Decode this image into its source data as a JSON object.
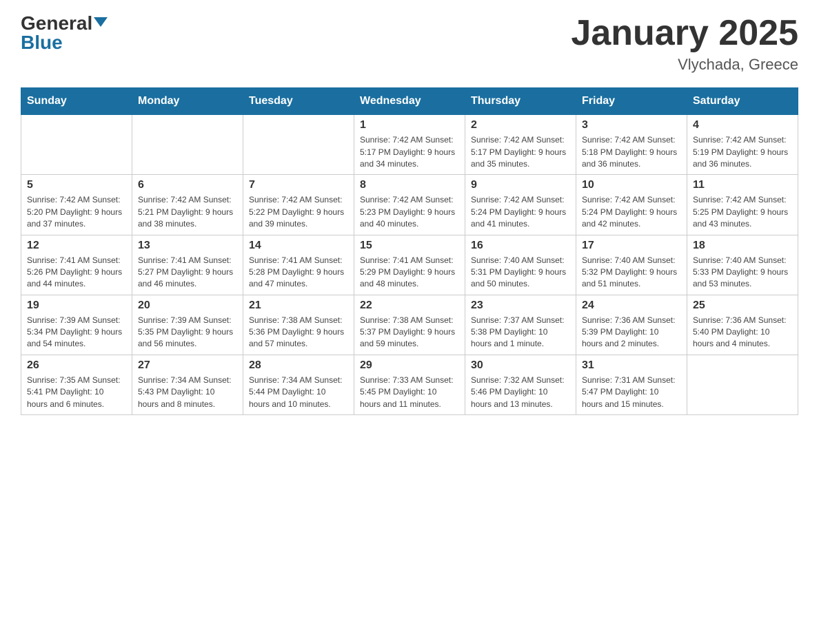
{
  "header": {
    "logo_general": "General",
    "logo_blue": "Blue",
    "month_title": "January 2025",
    "location": "Vlychada, Greece"
  },
  "days_of_week": [
    "Sunday",
    "Monday",
    "Tuesday",
    "Wednesday",
    "Thursday",
    "Friday",
    "Saturday"
  ],
  "weeks": [
    [
      {
        "day": "",
        "info": ""
      },
      {
        "day": "",
        "info": ""
      },
      {
        "day": "",
        "info": ""
      },
      {
        "day": "1",
        "info": "Sunrise: 7:42 AM\nSunset: 5:17 PM\nDaylight: 9 hours and 34 minutes."
      },
      {
        "day": "2",
        "info": "Sunrise: 7:42 AM\nSunset: 5:17 PM\nDaylight: 9 hours and 35 minutes."
      },
      {
        "day": "3",
        "info": "Sunrise: 7:42 AM\nSunset: 5:18 PM\nDaylight: 9 hours and 36 minutes."
      },
      {
        "day": "4",
        "info": "Sunrise: 7:42 AM\nSunset: 5:19 PM\nDaylight: 9 hours and 36 minutes."
      }
    ],
    [
      {
        "day": "5",
        "info": "Sunrise: 7:42 AM\nSunset: 5:20 PM\nDaylight: 9 hours and 37 minutes."
      },
      {
        "day": "6",
        "info": "Sunrise: 7:42 AM\nSunset: 5:21 PM\nDaylight: 9 hours and 38 minutes."
      },
      {
        "day": "7",
        "info": "Sunrise: 7:42 AM\nSunset: 5:22 PM\nDaylight: 9 hours and 39 minutes."
      },
      {
        "day": "8",
        "info": "Sunrise: 7:42 AM\nSunset: 5:23 PM\nDaylight: 9 hours and 40 minutes."
      },
      {
        "day": "9",
        "info": "Sunrise: 7:42 AM\nSunset: 5:24 PM\nDaylight: 9 hours and 41 minutes."
      },
      {
        "day": "10",
        "info": "Sunrise: 7:42 AM\nSunset: 5:24 PM\nDaylight: 9 hours and 42 minutes."
      },
      {
        "day": "11",
        "info": "Sunrise: 7:42 AM\nSunset: 5:25 PM\nDaylight: 9 hours and 43 minutes."
      }
    ],
    [
      {
        "day": "12",
        "info": "Sunrise: 7:41 AM\nSunset: 5:26 PM\nDaylight: 9 hours and 44 minutes."
      },
      {
        "day": "13",
        "info": "Sunrise: 7:41 AM\nSunset: 5:27 PM\nDaylight: 9 hours and 46 minutes."
      },
      {
        "day": "14",
        "info": "Sunrise: 7:41 AM\nSunset: 5:28 PM\nDaylight: 9 hours and 47 minutes."
      },
      {
        "day": "15",
        "info": "Sunrise: 7:41 AM\nSunset: 5:29 PM\nDaylight: 9 hours and 48 minutes."
      },
      {
        "day": "16",
        "info": "Sunrise: 7:40 AM\nSunset: 5:31 PM\nDaylight: 9 hours and 50 minutes."
      },
      {
        "day": "17",
        "info": "Sunrise: 7:40 AM\nSunset: 5:32 PM\nDaylight: 9 hours and 51 minutes."
      },
      {
        "day": "18",
        "info": "Sunrise: 7:40 AM\nSunset: 5:33 PM\nDaylight: 9 hours and 53 minutes."
      }
    ],
    [
      {
        "day": "19",
        "info": "Sunrise: 7:39 AM\nSunset: 5:34 PM\nDaylight: 9 hours and 54 minutes."
      },
      {
        "day": "20",
        "info": "Sunrise: 7:39 AM\nSunset: 5:35 PM\nDaylight: 9 hours and 56 minutes."
      },
      {
        "day": "21",
        "info": "Sunrise: 7:38 AM\nSunset: 5:36 PM\nDaylight: 9 hours and 57 minutes."
      },
      {
        "day": "22",
        "info": "Sunrise: 7:38 AM\nSunset: 5:37 PM\nDaylight: 9 hours and 59 minutes."
      },
      {
        "day": "23",
        "info": "Sunrise: 7:37 AM\nSunset: 5:38 PM\nDaylight: 10 hours and 1 minute."
      },
      {
        "day": "24",
        "info": "Sunrise: 7:36 AM\nSunset: 5:39 PM\nDaylight: 10 hours and 2 minutes."
      },
      {
        "day": "25",
        "info": "Sunrise: 7:36 AM\nSunset: 5:40 PM\nDaylight: 10 hours and 4 minutes."
      }
    ],
    [
      {
        "day": "26",
        "info": "Sunrise: 7:35 AM\nSunset: 5:41 PM\nDaylight: 10 hours and 6 minutes."
      },
      {
        "day": "27",
        "info": "Sunrise: 7:34 AM\nSunset: 5:43 PM\nDaylight: 10 hours and 8 minutes."
      },
      {
        "day": "28",
        "info": "Sunrise: 7:34 AM\nSunset: 5:44 PM\nDaylight: 10 hours and 10 minutes."
      },
      {
        "day": "29",
        "info": "Sunrise: 7:33 AM\nSunset: 5:45 PM\nDaylight: 10 hours and 11 minutes."
      },
      {
        "day": "30",
        "info": "Sunrise: 7:32 AM\nSunset: 5:46 PM\nDaylight: 10 hours and 13 minutes."
      },
      {
        "day": "31",
        "info": "Sunrise: 7:31 AM\nSunset: 5:47 PM\nDaylight: 10 hours and 15 minutes."
      },
      {
        "day": "",
        "info": ""
      }
    ]
  ]
}
